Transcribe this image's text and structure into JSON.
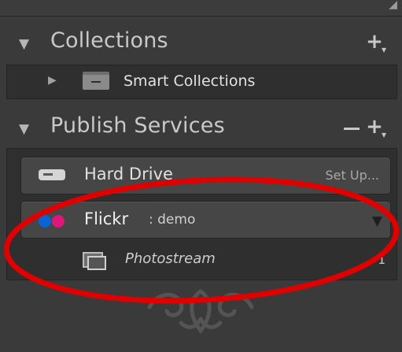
{
  "collections": {
    "title": "Collections",
    "items": [
      {
        "label": "Smart Collections"
      }
    ]
  },
  "publish_services": {
    "title": "Publish Services",
    "services": [
      {
        "label": "Hard Drive",
        "action": "Set Up..."
      },
      {
        "label": "Flickr",
        "account": ": demo",
        "children": [
          {
            "label": "Photostream",
            "count": "1"
          }
        ]
      }
    ]
  },
  "colors": {
    "highlight_ellipse": "#e10000",
    "flickr_blue": "#0a63d4",
    "flickr_pink": "#e0177a"
  },
  "icons": {
    "collapse": "triangle-down-icon",
    "expand": "triangle-right-icon",
    "smart_collection": "smart-collection-folder-icon",
    "hard_drive": "hard-drive-icon",
    "flickr": "flickr-logo-icon",
    "photostream": "photostream-collection-icon",
    "add": "plus-icon",
    "remove": "minus-icon",
    "ornament": "panel-end-ornament"
  }
}
